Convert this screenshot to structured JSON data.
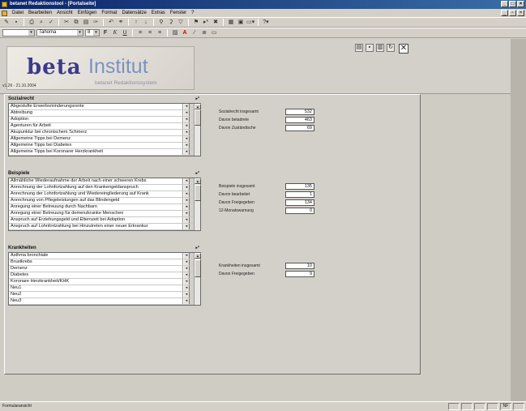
{
  "window": {
    "title": "betanet Redaktionstool - [Portalseite]"
  },
  "menu": [
    "Datei",
    "Bearbeiten",
    "Ansicht",
    "Einfügen",
    "Format",
    "Datensätze",
    "Extras",
    "Fenster",
    "?"
  ],
  "toolbar2": {
    "font": "Tahoma",
    "size": "8"
  },
  "logo": {
    "beta": "beta",
    "institut": "Institut",
    "subtitle": "betanet Redaktionssystem"
  },
  "version": "v1.26 - 21.10.2004",
  "sections": {
    "sozialrecht": {
      "title": "Sozialrecht",
      "items": [
        "Abgestufte Erwerbsminderungsrente",
        "Abtreibung",
        "Adoption",
        "Agenturen für Arbeit",
        "Akupunktur bei chronischem Schmerz",
        "Allgemeine Tipps bei Demenz",
        "Allgemeine Tipps bei Diabetes",
        "Allgemeine Tipps bei Koronarer Herzkrankheit"
      ],
      "stats": [
        {
          "label": "Sozialrecht insgesamt",
          "value": "532"
        },
        {
          "label": "Davon betadrete",
          "value": "463"
        },
        {
          "label": "Davon Zuständische",
          "value": "69"
        }
      ]
    },
    "beispiele": {
      "title": "Beispiele",
      "items": [
        "Allmähliche Wiederaufnahme der Arbeit nach einer schweren Krebs",
        "Anrechnung der Lohnfortzahlung auf den Krankengeldanspruch",
        "Anrechnung der Lohnfortzahlung und Wiedereingliederung auf Krank",
        "Anrechnung von Pflegeleistungen auf das Blindengeld",
        "Anregung einer Betreuung durch Nachbarn",
        "Anregung einer Betreuung für demenzkranke Menschen",
        "Anspruch auf Erziehungsgeld und Elternzeit bei Adoption",
        "Anspruch auf Lohnfortzahlung bei Hinzutreten einer neuer Erkrankur"
      ],
      "stats": [
        {
          "label": "Beispiele insgesamt",
          "value": "135"
        },
        {
          "label": "Davon bearbeitet",
          "value": "1"
        },
        {
          "label": "Davon Freigegeben",
          "value": "134"
        },
        {
          "label": "12-Monatswarnung",
          "value": "0"
        }
      ]
    },
    "krankheiten": {
      "title": "Krankheiten",
      "items": [
        "Asthma bronchiale",
        "Brustkrebs",
        "Demenz",
        "Diabetes",
        "Koronare Herzkrankheit/KHK",
        "Neu1",
        "Neu2",
        "Neu3"
      ],
      "stats": [
        {
          "label": "Krankheiten insgesamt",
          "value": "10"
        },
        {
          "label": "Davon Freigegeben",
          "value": "9"
        }
      ]
    }
  },
  "statusbar": {
    "text": "Formularansicht",
    "indicator": "NF"
  }
}
